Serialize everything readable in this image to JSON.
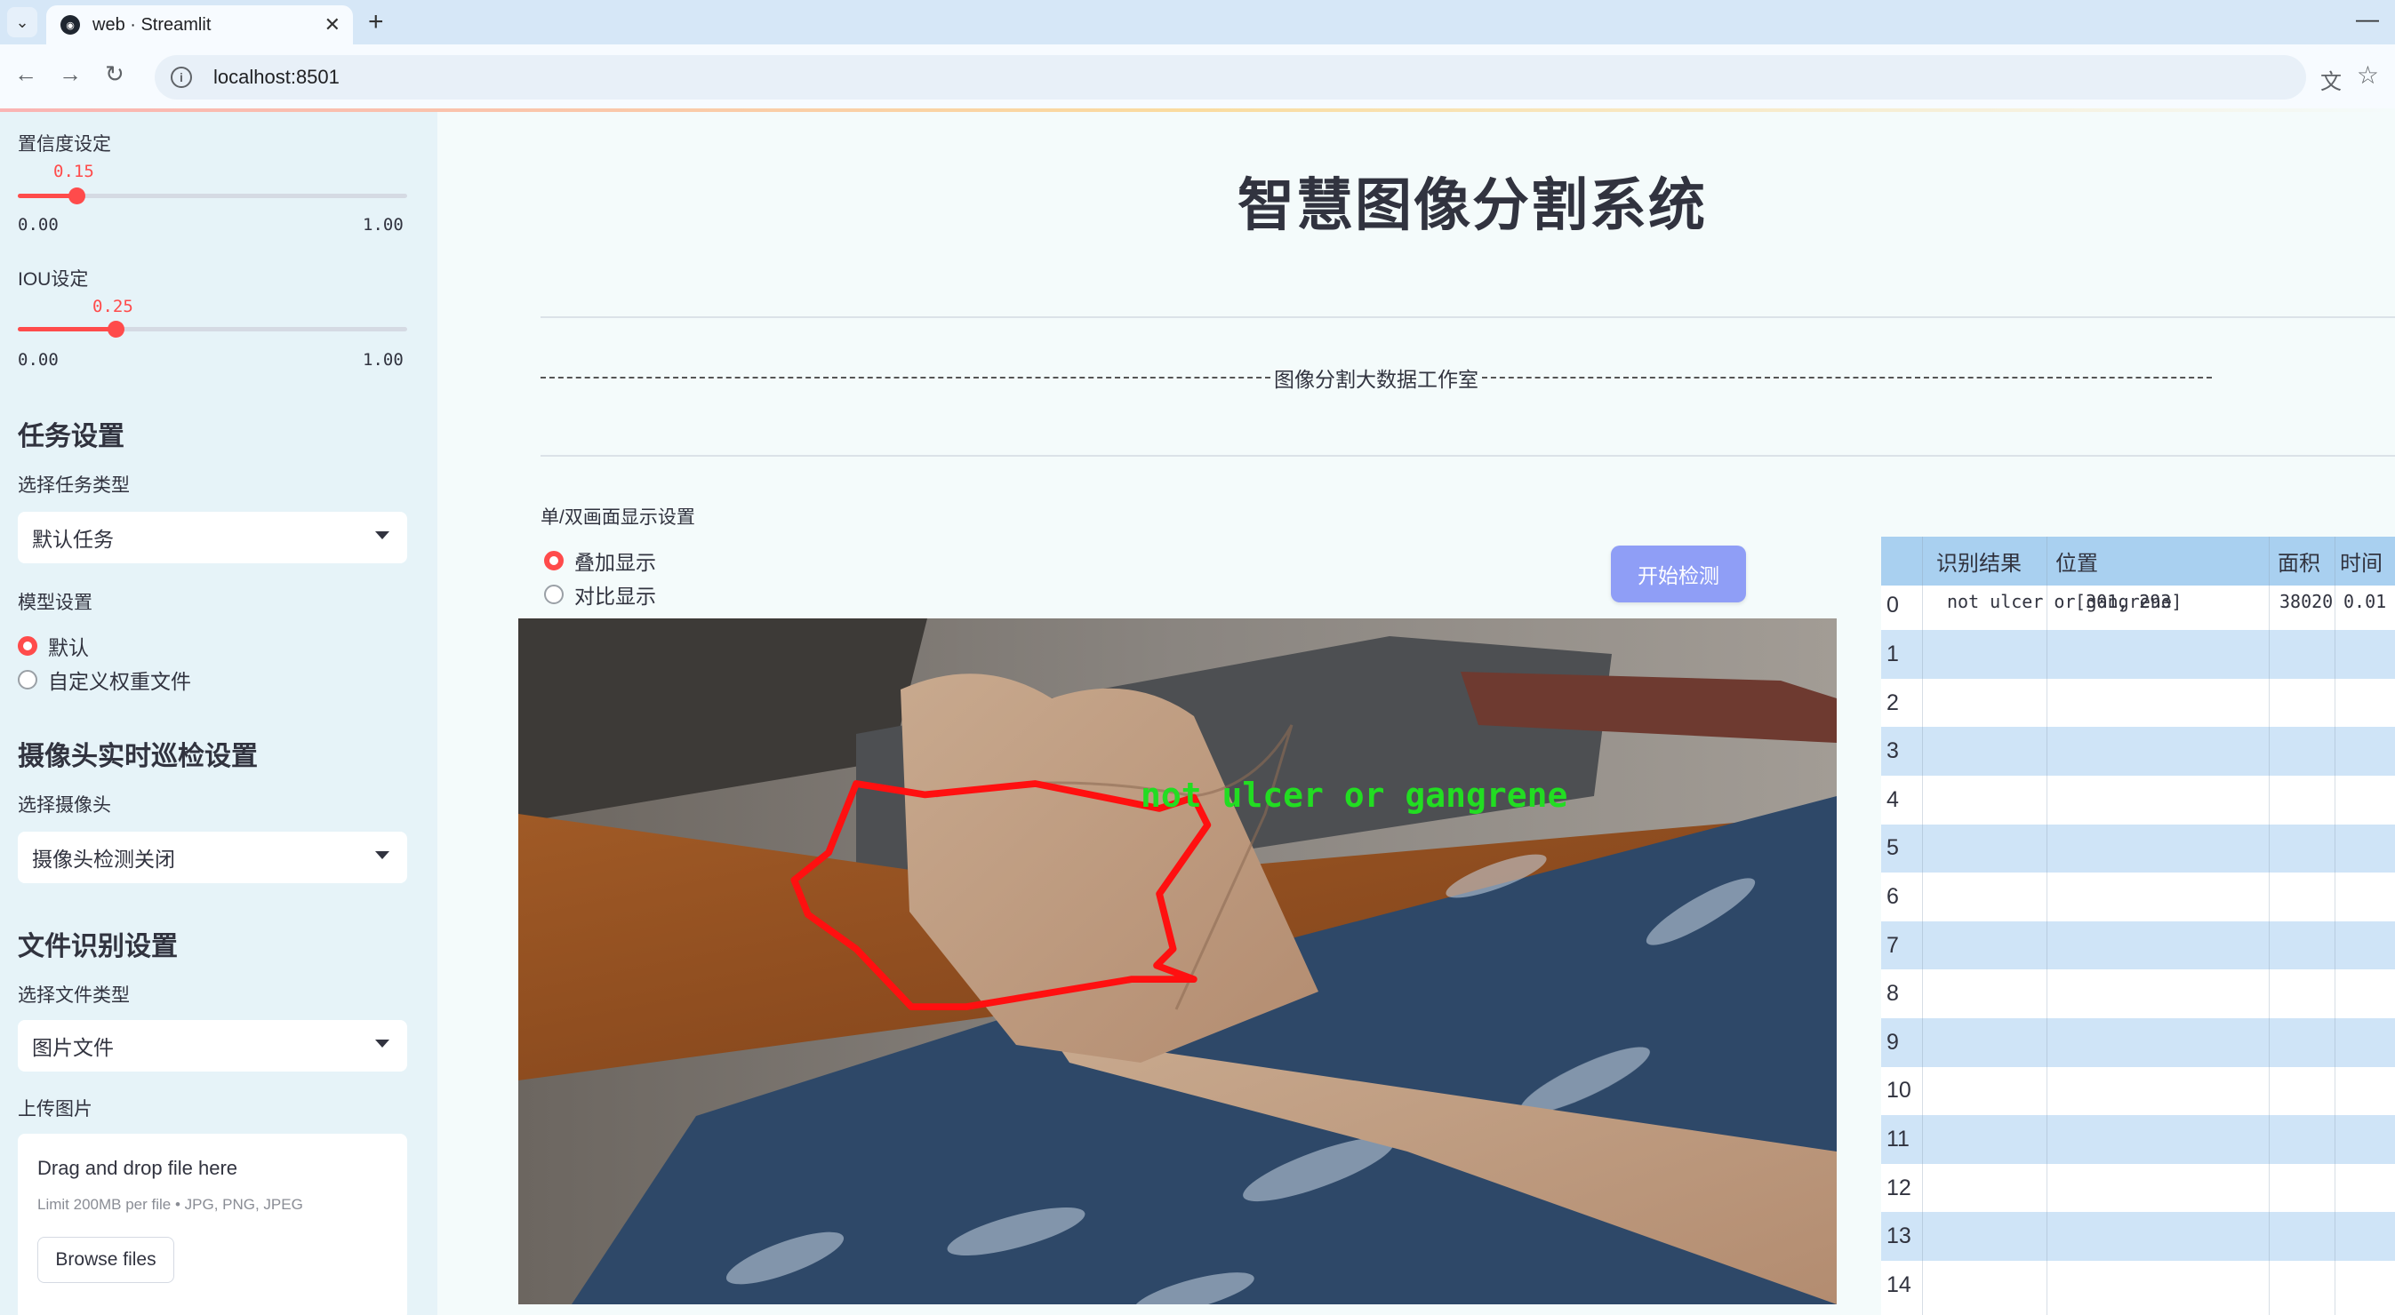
{
  "browser": {
    "tab_title": "web · Streamlit",
    "url": "localhost:8501"
  },
  "sidebar": {
    "confidence": {
      "label": "置信度设定",
      "value": "0.15",
      "min": "0.00",
      "max": "1.00",
      "fraction": 0.15
    },
    "iou": {
      "label": "IOU设定",
      "value": "0.25",
      "min": "0.00",
      "max": "1.00",
      "fraction": 0.25
    },
    "task_header": "任务设置",
    "task_type_label": "选择任务类型",
    "task_type_value": "默认任务",
    "model_label": "模型设置",
    "model_options": [
      "默认",
      "自定义权重文件"
    ],
    "model_selected": 0,
    "camera_header": "摄像头实时巡检设置",
    "camera_label": "选择摄像头",
    "camera_value": "摄像头检测关闭",
    "file_header": "文件识别设置",
    "file_type_label": "选择文件类型",
    "file_type_value": "图片文件",
    "upload_label": "上传图片",
    "upload_title": "Drag and drop file here",
    "upload_limit": "Limit 200MB per file • JPG, PNG, JPEG",
    "browse_label": "Browse files"
  },
  "main": {
    "title": "智慧图像分割系统",
    "studio_text": "图像分割大数据工作室",
    "display_label": "单/双画面显示设置",
    "display_options": [
      "叠加显示",
      "对比显示"
    ],
    "display_selected": 0,
    "start_button": "开始检测",
    "detection_label": "not ulcer or gangrene",
    "colors": {
      "mask": "#ff1010",
      "label": "#22dd22",
      "button": "#8f9ef6",
      "accent": "#ff4b4b"
    }
  },
  "table": {
    "headers": [
      "识别结果",
      "位置",
      "面积",
      "时间"
    ],
    "rows": [
      {
        "idx": "0",
        "result": "not ulcer or gangrene",
        "pos": "[301, 293]",
        "area": "38020",
        "time": "0.01"
      },
      {
        "idx": "1"
      },
      {
        "idx": "2"
      },
      {
        "idx": "3"
      },
      {
        "idx": "4"
      },
      {
        "idx": "5"
      },
      {
        "idx": "6"
      },
      {
        "idx": "7"
      },
      {
        "idx": "8"
      },
      {
        "idx": "9"
      },
      {
        "idx": "10"
      },
      {
        "idx": "11"
      },
      {
        "idx": "12"
      },
      {
        "idx": "13"
      },
      {
        "idx": "14"
      }
    ]
  }
}
